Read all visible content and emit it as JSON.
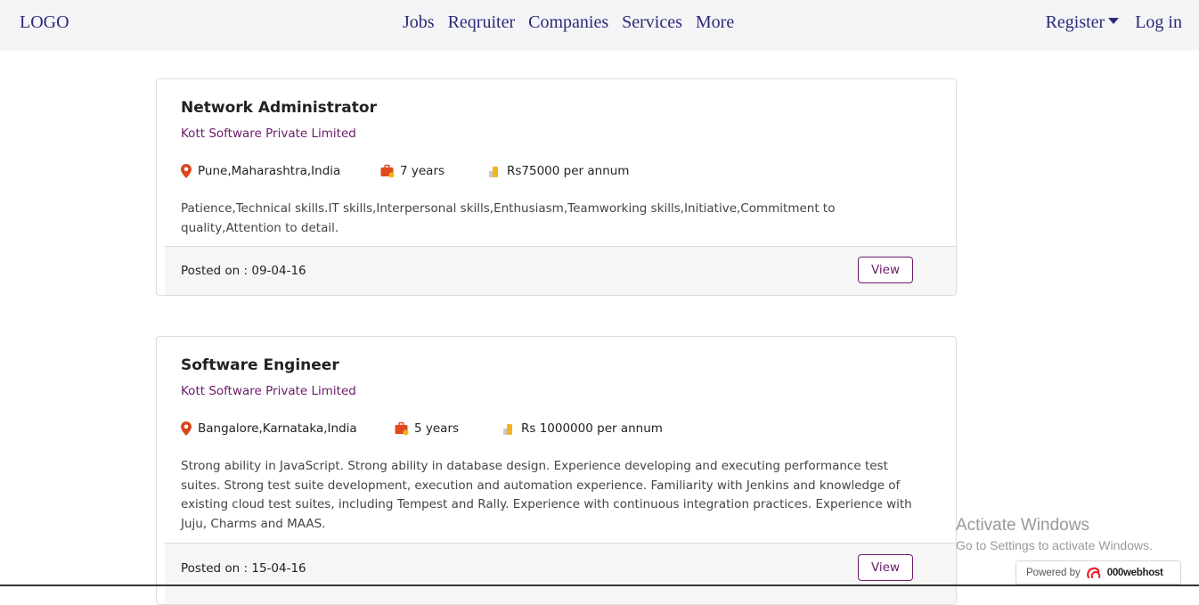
{
  "header": {
    "logo": "LOGO",
    "nav": [
      "Jobs",
      "Reqruiter",
      "Companies",
      "Services",
      "More"
    ],
    "register": "Register",
    "login": "Log in"
  },
  "jobs": [
    {
      "title": "Network Administrator",
      "company": "Kott Software Private Limited",
      "location": "Pune,Maharashtra,India",
      "experience": "7 years",
      "salary": "Rs75000 per annum",
      "description": "Patience,Technical skills.IT skills,Interpersonal skills,Enthusiasm,Teamworking skills,Initiative,Commitment to quality,Attention to detail.",
      "posted": "Posted on : 09-04-16",
      "view_label": "View"
    },
    {
      "title": "Software Engineer",
      "company": "Kott Software Private Limited",
      "location": "Bangalore,Karnataka,India",
      "experience": "5 years",
      "salary": "Rs 1000000 per annum",
      "description": "Strong ability in JavaScript. Strong ability in database design. Experience developing and executing performance test suites. Strong test suite development, execution and automation experience. Familiarity with Jenkins and knowledge of existing cloud test suites, including Tempest and Rally. Experience with continuous integration practices. Experience with Juju, Charms and MAAS.",
      "posted": "Posted on : 15-04-16",
      "view_label": "View"
    }
  ],
  "watermark": {
    "title": "Activate Windows",
    "subtitle": "Go to Settings to activate Windows."
  },
  "powered": {
    "label": "Powered by",
    "brand": "000webhost"
  },
  "colors": {
    "nav_text": "#2a2a7a",
    "company_text": "#6a1b6a",
    "header_bg": "#f5f5f7",
    "pin": "#d9461c",
    "bag": "#e14a1f",
    "money": "#f2b51b"
  }
}
